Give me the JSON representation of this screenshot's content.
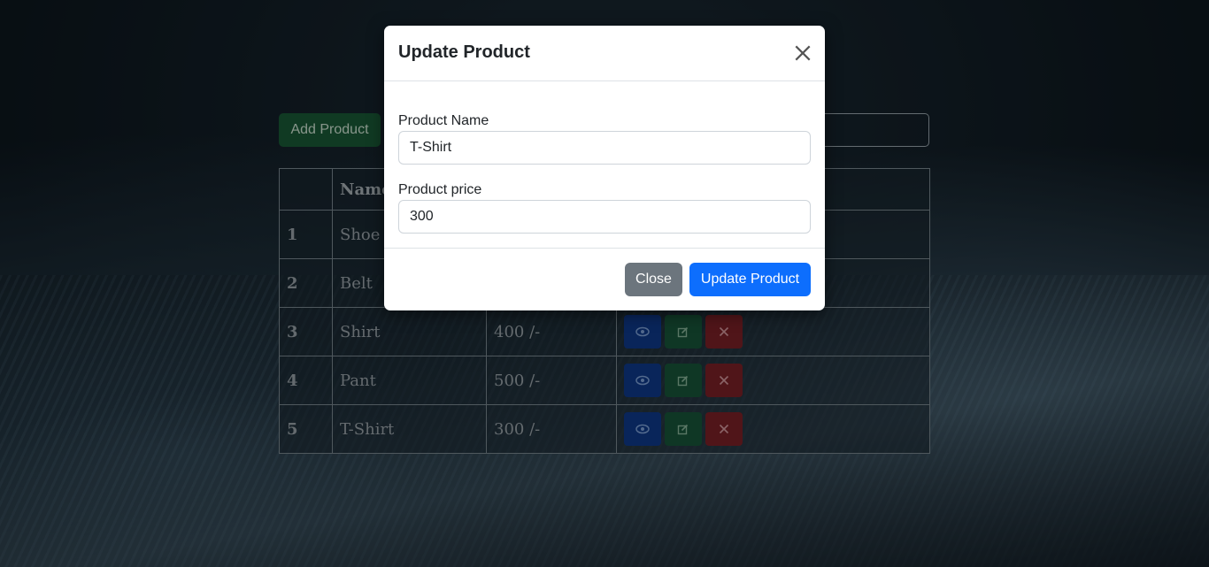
{
  "toolbar": {
    "add_label": "Add Product",
    "search_value": ""
  },
  "table": {
    "headers": [
      "",
      "Name",
      "",
      ""
    ],
    "rows": [
      {
        "index": "1",
        "name": "Shoe",
        "price": ""
      },
      {
        "index": "2",
        "name": "Belt",
        "price": ""
      },
      {
        "index": "3",
        "name": "Shirt",
        "price": "400 /-"
      },
      {
        "index": "4",
        "name": "Pant",
        "price": "500 /-"
      },
      {
        "index": "5",
        "name": "T-Shirt",
        "price": "300 /-"
      }
    ],
    "action_icons": [
      "eye-icon",
      "edit-icon",
      "close-icon"
    ]
  },
  "modal": {
    "title": "Update Product",
    "name_label": "Product Name",
    "name_value": "T-Shirt",
    "price_label": "Product price",
    "price_value": "300",
    "close_label": "Close",
    "update_label": "Update Product"
  },
  "colors": {
    "view": "#0e3a8a",
    "edit": "#17553a",
    "delete": "#7b2127",
    "primary": "#0d6efd",
    "secondary": "#6c757d"
  }
}
